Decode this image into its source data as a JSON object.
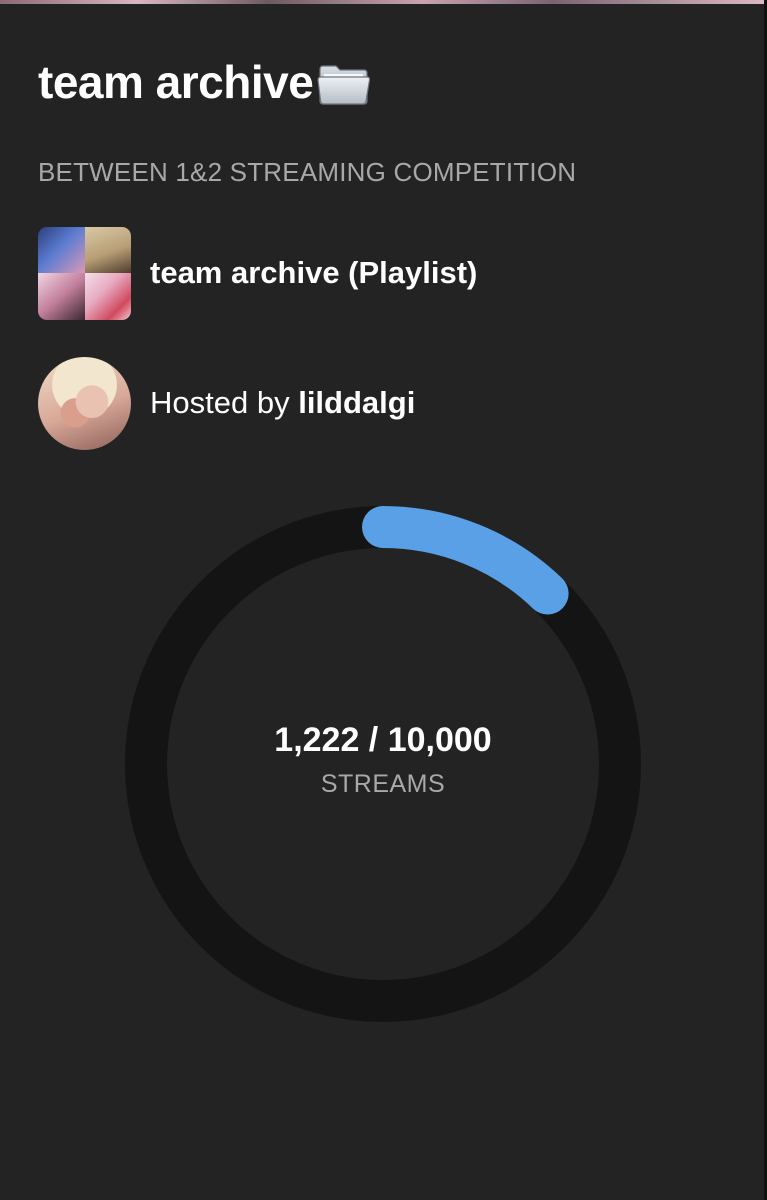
{
  "header": {
    "title": "team archive",
    "title_icon": "file-folder-icon",
    "subtitle": "BETWEEN 1&2 STREAMING COMPETITION"
  },
  "playlist": {
    "label": "team archive (Playlist)",
    "thumbnail": "playlist-cover-collage"
  },
  "host": {
    "prefix": "Hosted by",
    "name": "lilddalgi",
    "avatar": "host-avatar"
  },
  "progress": {
    "current": 1222,
    "goal": 10000,
    "fraction": 0.1222,
    "count_text": "1,222 / 10,000",
    "unit_label": "STREAMS"
  },
  "colors": {
    "background": "#232323",
    "ring_track": "#141414",
    "ring_progress": "#5aa0e6",
    "muted_text": "#a8a8a8"
  }
}
